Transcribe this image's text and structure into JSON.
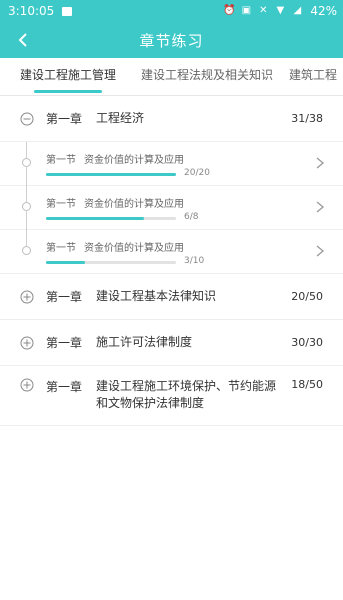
{
  "statusbar": {
    "time": "3:10:05",
    "battery": "42%",
    "icons": [
      "image-icon",
      "alarm-icon",
      "nfc-icon",
      "mute-icon",
      "wifi-icon",
      "signal-icon"
    ]
  },
  "header": {
    "title": "章节练习",
    "back_icon": "chevron-left-icon"
  },
  "tabs": [
    {
      "label": "建设工程施工管理",
      "active": true
    },
    {
      "label": "建设工程法规及相关知识",
      "active": false
    },
    {
      "label": "建筑工程",
      "active": false
    }
  ],
  "chapters": [
    {
      "num": "第一章",
      "name": "工程经济",
      "count": "31/38",
      "expanded": true,
      "sections": [
        {
          "num": "第一节",
          "name": "资金价值的计算及应用",
          "progress": "20/20",
          "ratio": 1.0
        },
        {
          "num": "第一节",
          "name": "资金价值的计算及应用",
          "progress": "6/8",
          "ratio": 0.75
        },
        {
          "num": "第一节",
          "name": "资金价值的计算及应用",
          "progress": "3/10",
          "ratio": 0.3
        }
      ]
    },
    {
      "num": "第一章",
      "name": "建设工程基本法律知识",
      "count": "20/50",
      "expanded": false
    },
    {
      "num": "第一章",
      "name": "施工许可法律制度",
      "count": "30/30",
      "expanded": false
    },
    {
      "num": "第一章",
      "name": "建设工程施工环境保护、节约能源和文物保护法律制度",
      "count": "18/50",
      "expanded": false
    }
  ],
  "colors": {
    "accent": "#3cc9c8",
    "track": "#e2e2e2"
  }
}
